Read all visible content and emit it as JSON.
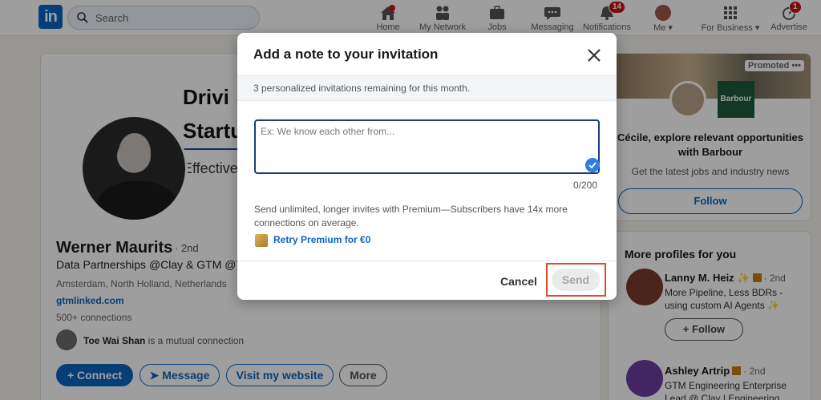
{
  "nav": {
    "logo": "in",
    "search_placeholder": "Search",
    "items": [
      {
        "label": "Home",
        "icon": "home-icon"
      },
      {
        "label": "My Network",
        "icon": "network-icon"
      },
      {
        "label": "Jobs",
        "icon": "jobs-icon"
      },
      {
        "label": "Messaging",
        "icon": "messaging-icon"
      },
      {
        "label": "Notifications",
        "icon": "bell-icon",
        "badge": "14"
      },
      {
        "label": "Me",
        "icon": "avatar"
      },
      {
        "label": "For Business",
        "icon": "grid-icon"
      },
      {
        "label": "Advertise",
        "icon": "advertise-icon",
        "badge": "1"
      }
    ]
  },
  "profile": {
    "banner_line1": "Drivi",
    "banner_line2": "Startu",
    "banner_sub": "Effective",
    "name": "Werner Maurits",
    "degree": "· 2nd",
    "headline": "Data Partnerships @Clay & GTM @Te",
    "location": "Amsterdam, North Holland, Netherlands",
    "website": "gtmlinked.com",
    "connections": "500+ connections",
    "mutual_name": "Toe Wai Shan",
    "mutual_suffix": " is a mutual connection",
    "connect_label": "Connect",
    "message_label": "Message",
    "visit_label": "Visit my website",
    "more_label": "More"
  },
  "promo": {
    "badge": "Promoted",
    "logo_text": "Barbour",
    "title": "Cécile, explore relevant opportunities with Barbour",
    "subtitle": "Get the latest jobs and industry news",
    "follow_label": "Follow"
  },
  "more_profiles": {
    "title": "More profiles for you",
    "people": [
      {
        "name": "Lanny M. Heiz",
        "degree": "· 2nd",
        "desc": "More Pipeline, Less BDRs - using custom AI Agents",
        "follow_label": "Follow"
      },
      {
        "name": "Ashley Artrip",
        "degree": "· 2nd",
        "desc": "GTM Engineering Enterprise Lead @ Clay | Engineering"
      }
    ]
  },
  "modal": {
    "title": "Add a note to your invitation",
    "banner": "3 personalized invitations remaining for this month.",
    "note_placeholder": "Ex: We know each other from...",
    "note_value": "",
    "counter": "0/200",
    "premium_text": "Send unlimited, longer invites with Premium—Subscribers have 14x more connections on average.",
    "premium_link": "Retry Premium for €0",
    "cancel_label": "Cancel",
    "send_label": "Send"
  },
  "colors": {
    "brand": "#0a66c2",
    "highlight": "#e04a2e",
    "badge": "#cc1016"
  }
}
